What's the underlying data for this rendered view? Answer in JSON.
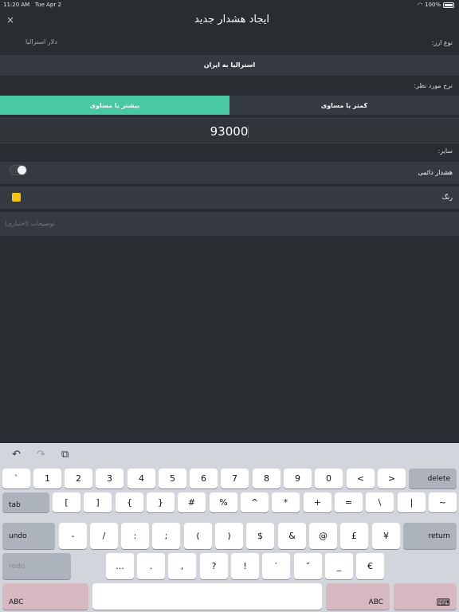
{
  "status": {
    "time": "11:20 AM",
    "date": "Tue Apr 2",
    "battery": "100%"
  },
  "nav": {
    "title": "ایجاد هشدار جدید",
    "close_glyph": "×"
  },
  "currency": {
    "label": "نوع ارز:",
    "value": "دلار استرالیا",
    "selection": "استرالیا به ایران"
  },
  "rate": {
    "label": "نرخ مورد نظر:",
    "seg_gte": "بیشتر یا مساوی",
    "seg_lte": "کمتر یا مساوی",
    "amount": "93000"
  },
  "other": {
    "label": "سایر:",
    "permanent_label": "هشدار دائمی",
    "color_label": "رنگ",
    "color_value": "#f2c318",
    "description_placeholder": "توضیحات (اختیاری)"
  },
  "keyboard": {
    "toolbar": {
      "undo": "↶",
      "redo": "↷",
      "paste": "⧉"
    },
    "row1": [
      "`",
      "1",
      "2",
      "3",
      "4",
      "5",
      "6",
      "7",
      "8",
      "9",
      "0",
      "<",
      ">"
    ],
    "delete": "delete",
    "tab": "tab",
    "row2": [
      "[",
      "]",
      "{",
      "}",
      "#",
      "%",
      "^",
      "*",
      "+",
      "=",
      "\\",
      "|",
      "~"
    ],
    "undo": "undo",
    "row3": [
      "-",
      "/",
      ":",
      ";",
      "(",
      ")",
      "$",
      "&",
      "@",
      "£",
      "¥"
    ],
    "return": "return",
    "redo": "redo",
    "row4": [
      "...",
      ".",
      ",",
      "?",
      "!",
      "′",
      "″",
      "_",
      "€"
    ],
    "abc_left": "ABC",
    "abc_right": "ABC",
    "dismiss": "⌨"
  }
}
